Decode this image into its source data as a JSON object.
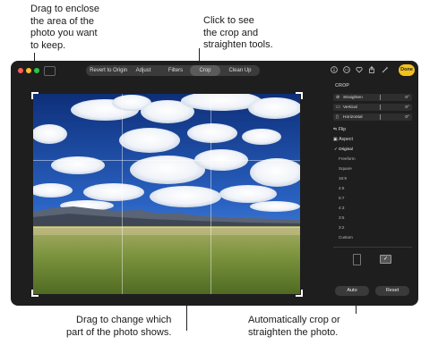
{
  "callouts": {
    "top_left": "Drag to enclose\nthe area of the\nphoto you want\nto keep.",
    "top_right": "Click to see\nthe crop and\nstraighten tools.",
    "bottom_left": "Drag to change which\npart of the photo shows.",
    "bottom_right": "Automatically crop or\nstraighten the photo."
  },
  "toolbar": {
    "revert_label": "Revert to Original",
    "tabs": [
      "Adjust",
      "Filters",
      "Crop",
      "Clean Up"
    ],
    "active_tab": "Crop",
    "done_label": "Done",
    "icons": [
      "info-icon",
      "more-icon",
      "favorite-icon",
      "share-icon",
      "magic-wand-icon"
    ]
  },
  "panel": {
    "title": "CROP",
    "sliders": [
      {
        "label": "Straighten",
        "value": "0°",
        "icon": "straighten-icon"
      },
      {
        "label": "Vertical",
        "value": "0°",
        "icon": "vertical-icon"
      },
      {
        "label": "Horizontal",
        "value": "0°",
        "icon": "horizontal-icon"
      }
    ],
    "flip_label": "Flip",
    "aspect_label": "Aspect",
    "aspect_options": [
      "Original",
      "Freeform",
      "Square",
      "16:9",
      "4:5",
      "5:7",
      "4:3",
      "3:5",
      "3:2",
      "Custom"
    ],
    "selected_aspect": "Original",
    "auto_label": "Auto",
    "reset_label": "Reset",
    "traffic_colors": {
      "close": "#ff5f57",
      "minimize": "#febc2e",
      "zoom": "#28c840"
    },
    "accent": "#f3c21c"
  }
}
